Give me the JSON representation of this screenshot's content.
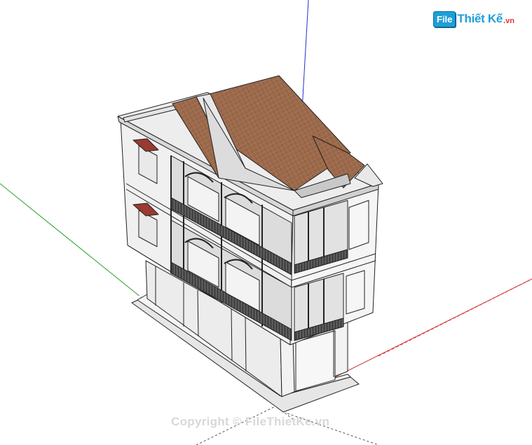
{
  "logo": {
    "badge": "File",
    "name": "Thiết Kế",
    "tld": ".vn"
  },
  "watermark": {
    "text": "Copyright © FileThietKe.vn"
  },
  "colors": {
    "background": "#ffffff",
    "roof": "#9c6a4c",
    "wall": "#efefef",
    "axis_red": "#d03030",
    "axis_green": "#2aa02a",
    "axis_blue": "#2030d0",
    "logo_blue": "#1e9fd8",
    "logo_red": "#e03636"
  },
  "scene": {
    "model": "three-storey-house",
    "axes": [
      "red-axis",
      "green-axis",
      "blue-axis"
    ]
  }
}
